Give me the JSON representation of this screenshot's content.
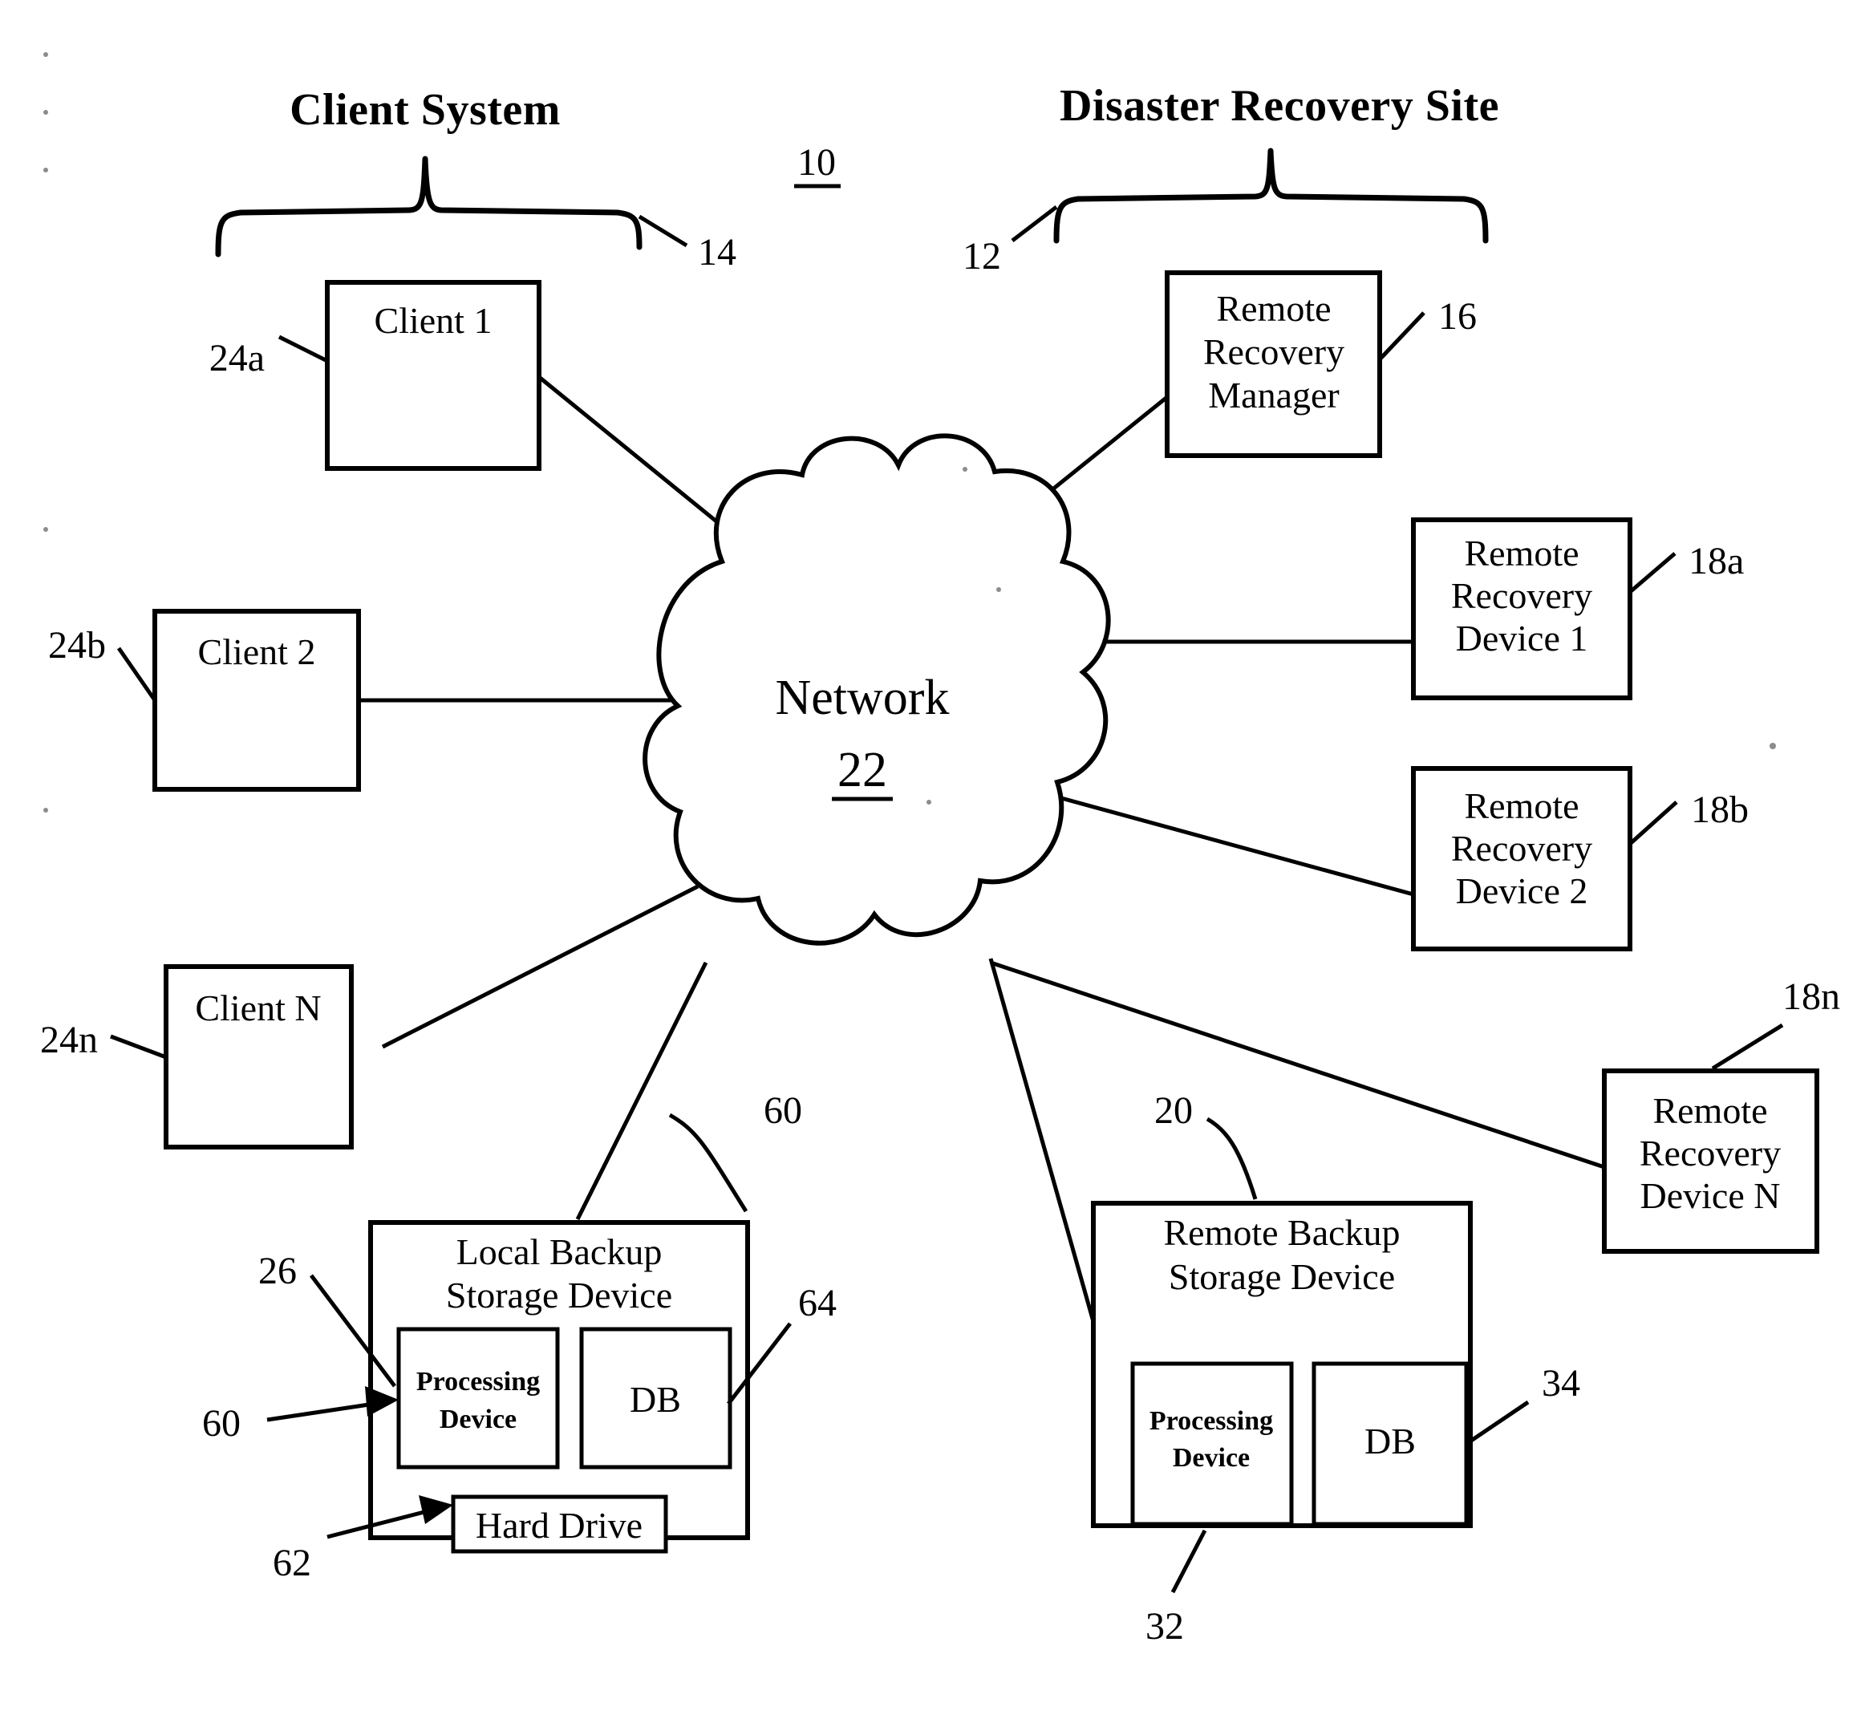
{
  "figure": {
    "figure_number": "10",
    "headings": {
      "left": "Client System",
      "right": "Disaster Recovery Site"
    },
    "reference_numerals": {
      "system": "10",
      "client_system_brace": "14",
      "disaster_recovery_brace": "12",
      "remote_recovery_manager": "16",
      "remote_recovery_device_1": "18a",
      "remote_recovery_device_2": "18b",
      "remote_recovery_device_n": "18n",
      "client_1": "24a",
      "client_2": "24b",
      "client_n": "24n",
      "network": "22",
      "local_backup_storage_device": "60",
      "local_processing_device_a": "26",
      "local_processing_device_b": "60",
      "local_hard_drive": "62",
      "local_db": "64",
      "remote_backup_storage_device": "20",
      "remote_processing_device": "32",
      "remote_db": "34"
    },
    "nodes": {
      "client_1": "Client 1",
      "client_2": "Client 2",
      "client_n": "Client N",
      "remote_recovery_manager": "Remote\nRecovery\nManager",
      "remote_recovery_manager_lines": [
        "Remote",
        "Recovery",
        "Manager"
      ],
      "remote_recovery_device_1_lines": [
        "Remote",
        "Recovery",
        "Device 1"
      ],
      "remote_recovery_device_2_lines": [
        "Remote",
        "Recovery",
        "Device 2"
      ],
      "remote_recovery_device_n_lines": [
        "Remote",
        "Recovery",
        "Device N"
      ],
      "network_label": "Network",
      "network_number": "22",
      "local_backup_lines": [
        "Local Backup",
        "Storage Device"
      ],
      "remote_backup_lines": [
        "Remote Backup",
        "Storage Device"
      ],
      "processing_device_lines": [
        "Processing",
        "Device"
      ],
      "db": "DB",
      "hard_drive": "Hard Drive"
    },
    "colors": {
      "ink": "#000000",
      "paper": "#ffffff"
    }
  }
}
